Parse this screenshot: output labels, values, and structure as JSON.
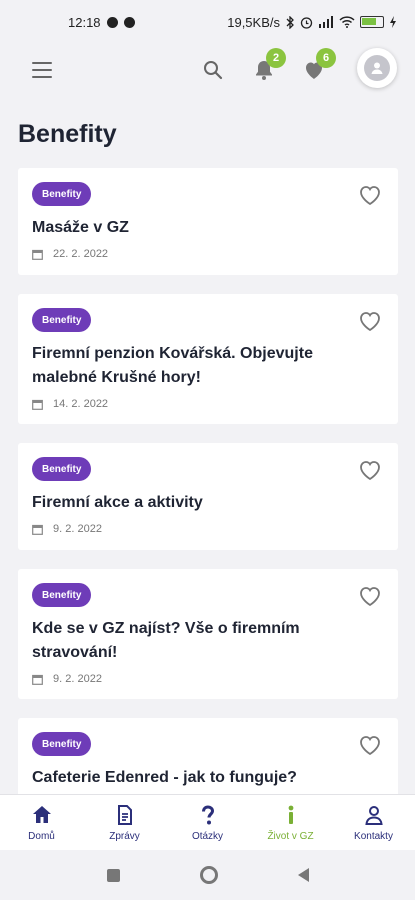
{
  "status_bar": {
    "time": "12:18",
    "net_speed": "19,5KB/s"
  },
  "topbar": {
    "notifications_count": "2",
    "favorites_count": "6"
  },
  "page": {
    "title": "Benefity"
  },
  "articles": [
    {
      "tag": "Benefity",
      "title": "Masáže v GZ",
      "date": "22. 2. 2022"
    },
    {
      "tag": "Benefity",
      "title": "Firemní penzion Kovářská. Objevujte malebné Krušné hory!",
      "date": "14. 2. 2022"
    },
    {
      "tag": "Benefity",
      "title": "Firemní akce a aktivity",
      "date": "9. 2. 2022"
    },
    {
      "tag": "Benefity",
      "title": "Kde se v GZ najíst? Vše o firemním stravování!",
      "date": "9. 2. 2022"
    },
    {
      "tag": "Benefity",
      "title": "Cafeterie Edenred - jak to funguje?",
      "date": ""
    }
  ],
  "bottom_nav": {
    "items": [
      {
        "label": "Domů",
        "icon": "home-icon"
      },
      {
        "label": "Zprávy",
        "icon": "document-icon"
      },
      {
        "label": "Otázky",
        "icon": "question-icon"
      },
      {
        "label": "Život v GZ",
        "icon": "info-icon",
        "active": true
      },
      {
        "label": "Kontakty",
        "icon": "person-icon"
      }
    ]
  },
  "colors": {
    "accent": "#6e3cb8",
    "badge": "#8bc43f",
    "nav_text": "#2b2f7a",
    "nav_active": "#7ab035"
  }
}
